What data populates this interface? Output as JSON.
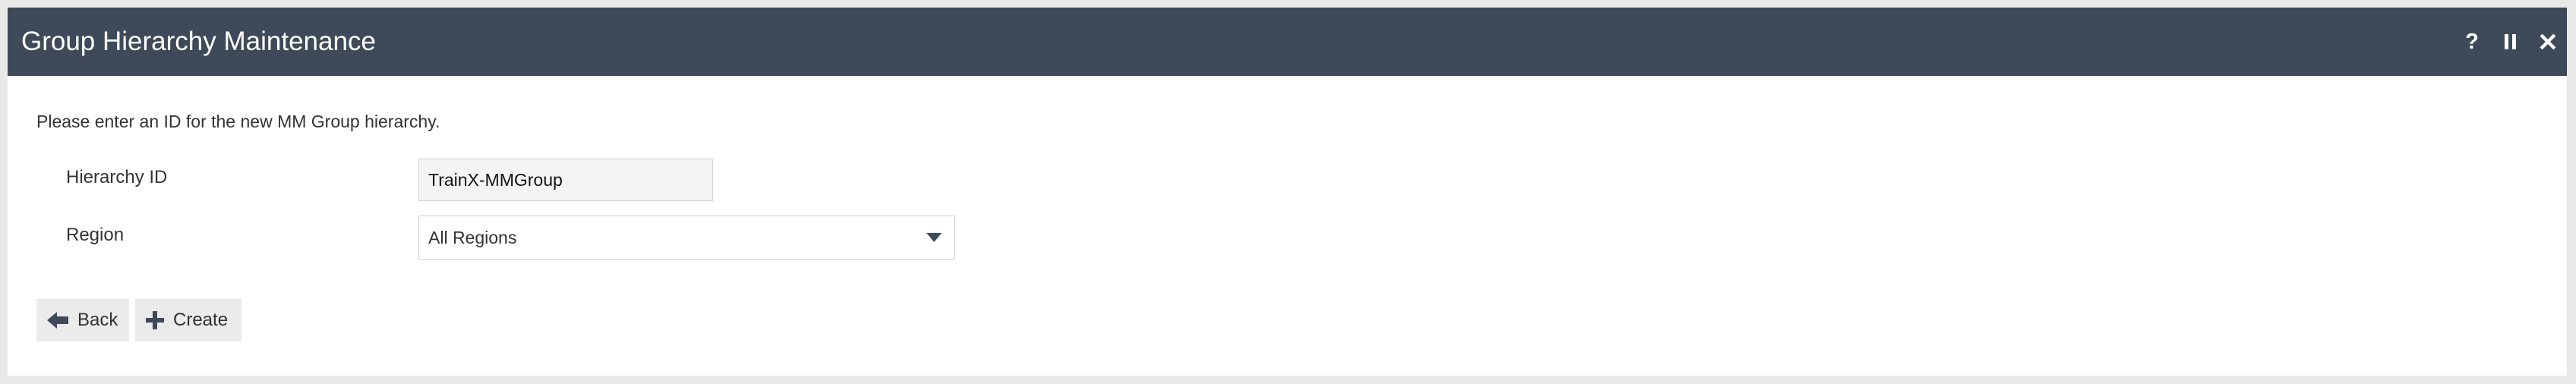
{
  "window": {
    "title": "Group Hierarchy Maintenance",
    "controls": {
      "help_label": "?",
      "pause_icon": "pause-icon",
      "close_label": "✕"
    }
  },
  "form": {
    "instruction": "Please enter an ID for the new MM Group hierarchy.",
    "hierarchy_id": {
      "label": "Hierarchy ID",
      "value": "TrainX-MMGroup"
    },
    "region": {
      "label": "Region",
      "selected": "All Regions"
    }
  },
  "buttons": {
    "back_label": "Back",
    "back_icon": "arrow-left-icon",
    "create_label": "Create",
    "create_icon": "plus-icon"
  },
  "colors": {
    "titlebar": "#3e4a59",
    "button_bg": "#ebebeb"
  }
}
